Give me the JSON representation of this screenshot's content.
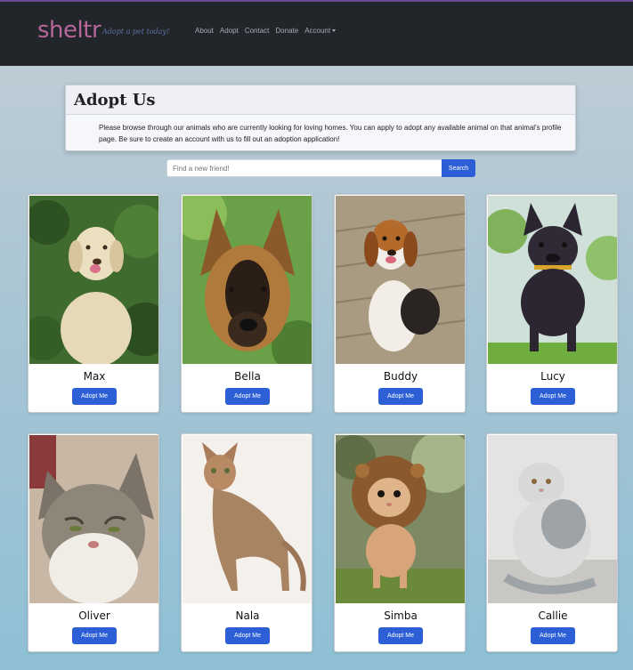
{
  "navbar": {
    "brand": "sheltr",
    "tagline": "Adopt a pet today!",
    "links": [
      "About",
      "Adopt",
      "Contact",
      "Donate",
      "Account"
    ]
  },
  "intro": {
    "title": "Adopt Us",
    "text": "Please browse through our animals who are currently looking for loving homes. You can apply to adopt any available animal on that animal's profile page. Be sure to create an account with us to fill out an adoption application!"
  },
  "search": {
    "placeholder": "Find a new friend!",
    "button": "Search"
  },
  "adopt_label": "Adopt Me",
  "pets": [
    {
      "name": "Max"
    },
    {
      "name": "Bella"
    },
    {
      "name": "Buddy"
    },
    {
      "name": "Lucy"
    },
    {
      "name": "Oliver"
    },
    {
      "name": "Nala"
    },
    {
      "name": "Simba"
    },
    {
      "name": "Callie"
    }
  ],
  "colors": {
    "navbar_bg": "#22252a",
    "brand": "#b5669a",
    "button": "#2c5fd6"
  }
}
